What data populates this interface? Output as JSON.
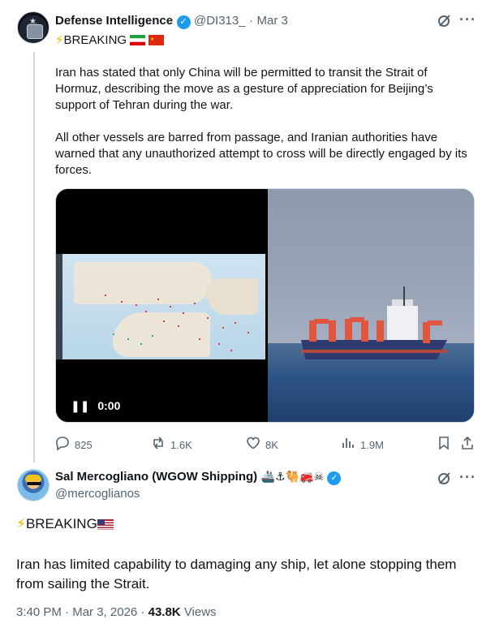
{
  "parent_tweet": {
    "author_name": "Defense Intelligence",
    "handle": "@DI313_",
    "separator": "·",
    "date": "Mar 3",
    "headline": "BREAKING",
    "paragraph_1": "Iran has stated that only China will be permitted to transit the Strait of Hormuz, describing the move as a gesture of appreciation for Beijing’s support of Tehran during the war.",
    "paragraph_2": "All other vessels are barred from passage, and Iranian authorities have warned that any unauthorized attempt to cross will be directly engaged by its forces.",
    "video_time": "0:00",
    "replies": "825",
    "reposts": "1.6K",
    "likes": "8K",
    "views": "1.9M"
  },
  "main_tweet": {
    "author_name": "Sal Mercogliano (WGOW Shipping)",
    "name_emojis": "🚢⚓🐫🚒☠",
    "handle": "@mercoglianos",
    "headline": "BREAKING",
    "body": "Iran has limited capability to damaging any ship, let alone stopping them from sailing the Strait.",
    "time": "3:40 PM",
    "separator": "·",
    "date": "Mar 3, 2026",
    "views_count": "43.8K",
    "views_label": "Views"
  },
  "icons": {
    "verified": "verified-badge-icon",
    "grok": "grok-icon",
    "more": "more-icon",
    "lightning": "lightning-emoji-icon"
  },
  "colors": {
    "accent": "#1d9bf0",
    "muted": "#536471",
    "text": "#0f1419"
  }
}
